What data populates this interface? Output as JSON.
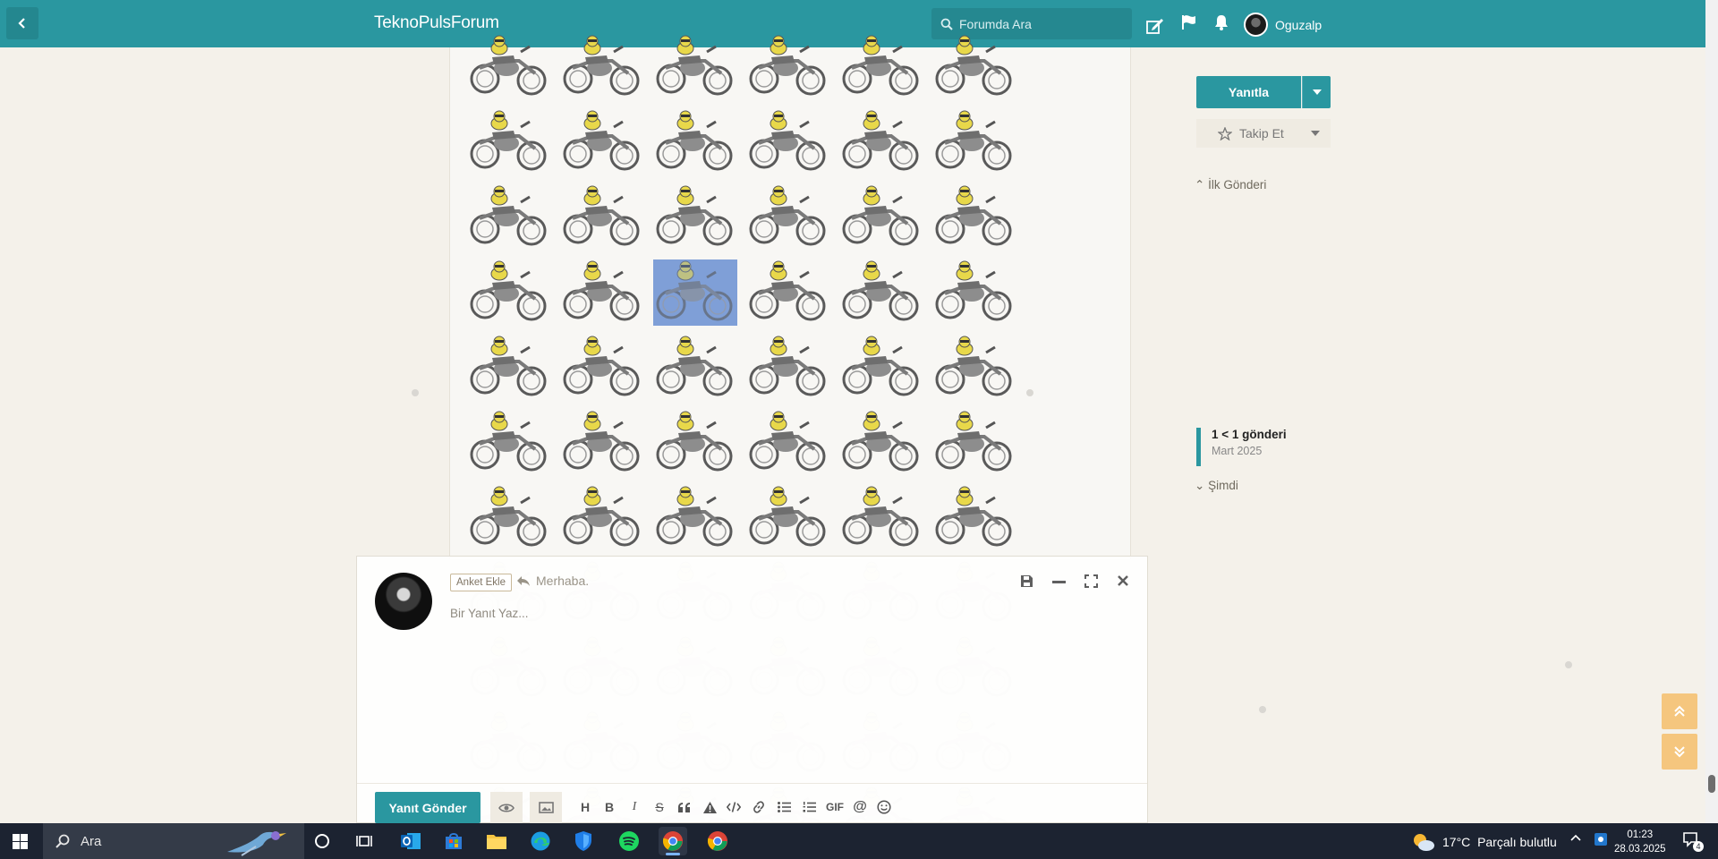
{
  "header": {
    "brand": "TeknoPulsForum",
    "search_placeholder": "Forumda Ara",
    "username": "Oguzalp"
  },
  "sidebar": {
    "reply_label": "Yanıtla",
    "follow_label": "Takip Et",
    "first_post_label": "İlk Gönderi",
    "timeline_position": "1 < 1 gönderi",
    "timeline_date": "Mart 2025",
    "now_label": "Şimdi"
  },
  "post": {
    "grid_rows": 7,
    "grid_cols": 6,
    "selected_row": 3,
    "selected_col": 2
  },
  "composer": {
    "poll_label": "Anket Ekle",
    "reply_to": "Merhaba.",
    "placeholder": "Bir Yanıt Yaz...",
    "send_label": "Yanıt Gönder",
    "toolbar": [
      "H",
      "B",
      "I",
      "S",
      "quote",
      "warning",
      "code",
      "link",
      "list-ul",
      "list-ol",
      "GIF",
      "@",
      "emoji"
    ]
  },
  "taskbar": {
    "search_placeholder": "Ara",
    "weather_temp": "17°C",
    "weather_desc": "Parçalı bulutlu",
    "time": "01:23",
    "date": "28.03.2025",
    "notification_count": "4"
  },
  "colors": {
    "accent": "#2a97a0",
    "background": "#f4f1ea",
    "scroll_buttons": "#f5c67e",
    "selection": "#7f9fd7"
  }
}
